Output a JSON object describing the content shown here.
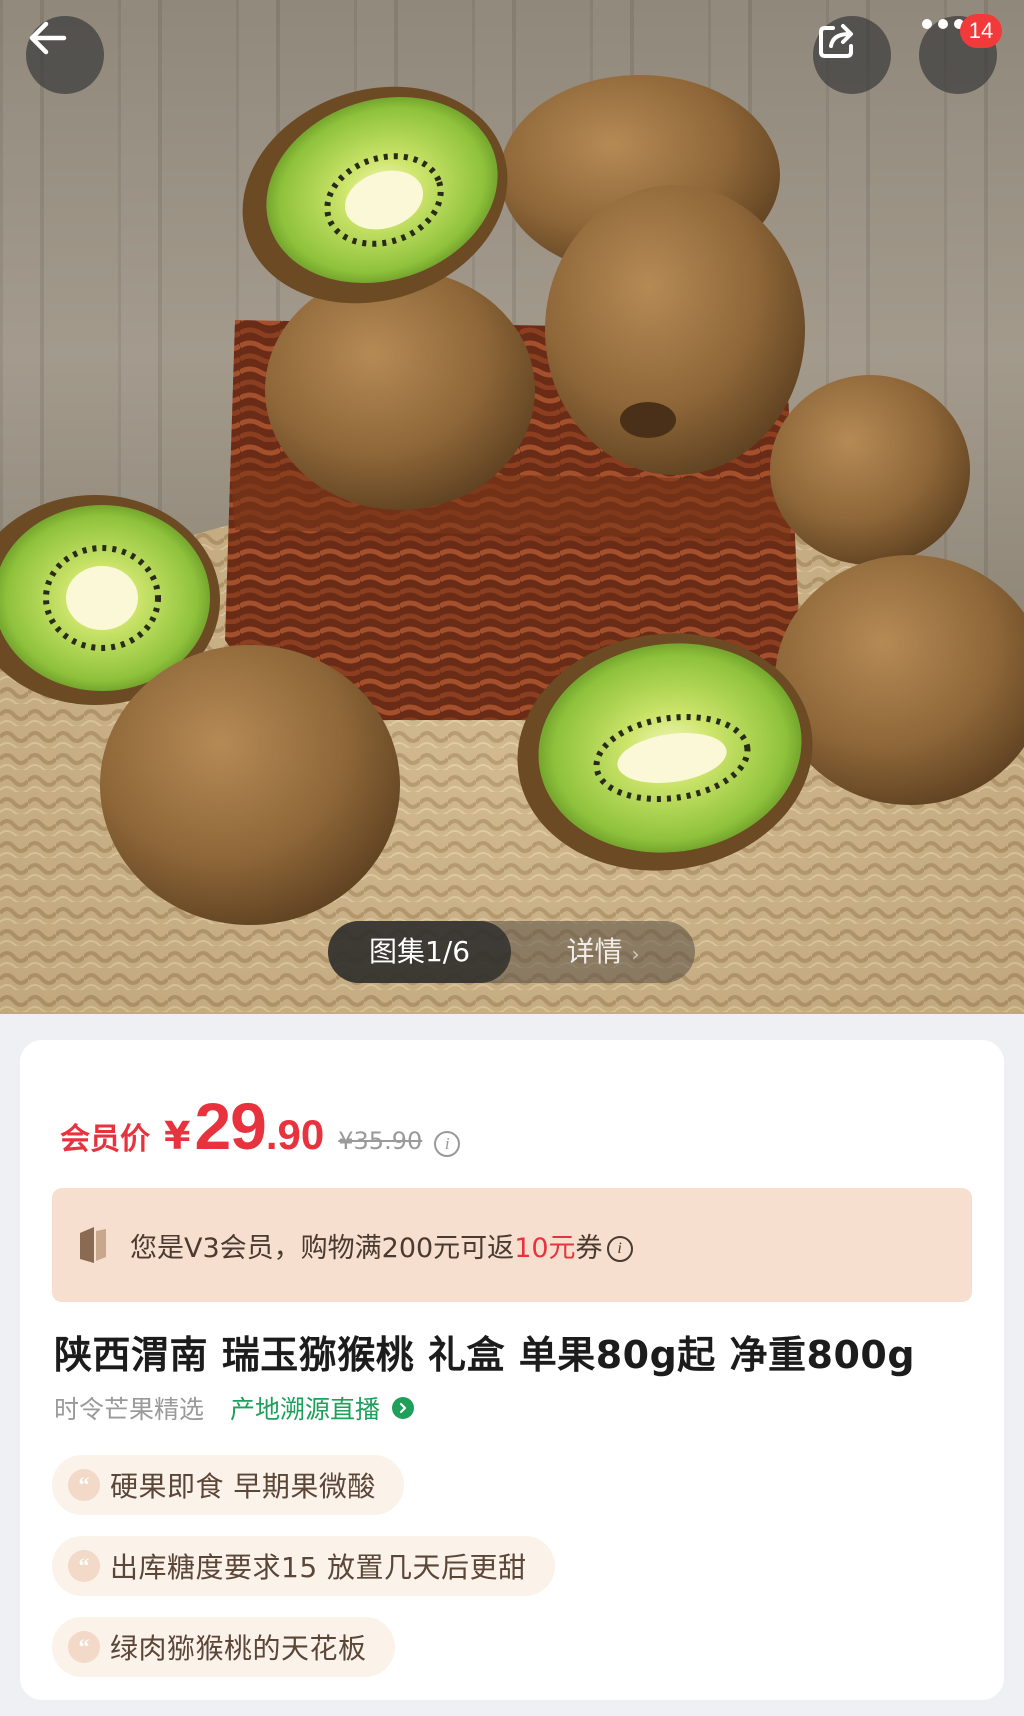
{
  "header": {
    "cart_badge": "14"
  },
  "gallery": {
    "active_label": "图集1/6",
    "detail_label": "详情"
  },
  "price": {
    "member_label": "会员价",
    "currency": "¥",
    "integer": "29",
    "decimal": ".90",
    "original": "¥35.90"
  },
  "vip_banner": {
    "prefix": "您是V3会员，购物满200元可返",
    "highlight": "10元",
    "suffix": "券"
  },
  "product": {
    "title": "陕西渭南 瑞玉猕猴桃 礼盒 单果80g起 净重800g",
    "seller": "时令芒果精选",
    "live_label": "产地溯源直播"
  },
  "tags": [
    "硬果即食 早期果微酸",
    "出库糖度要求15 放置几天后更甜",
    "绿肉猕猴桃的天花板"
  ],
  "colors": {
    "price_red": "#e8333f",
    "live_green": "#1fa05a",
    "banner_bg": "#f6dfcf"
  },
  "icons": {
    "back": "arrow-left-icon",
    "share": "share-icon",
    "more": "more-dots-icon",
    "info": "info-icon",
    "live_arrow": "chevron-right-icon"
  }
}
